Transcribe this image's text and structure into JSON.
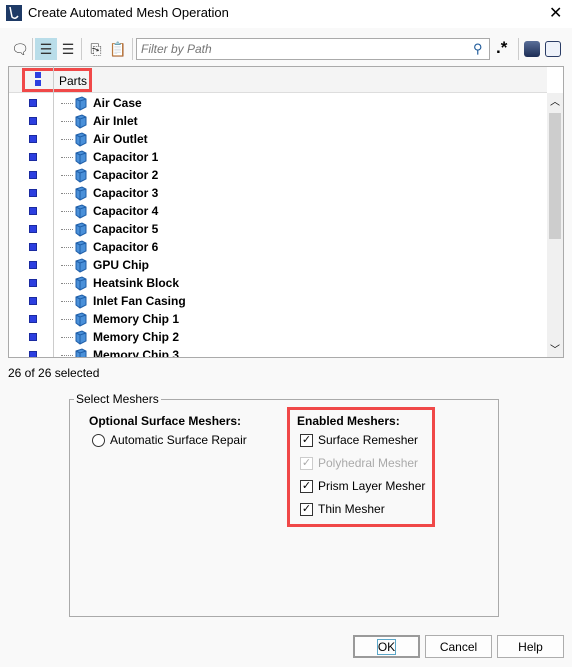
{
  "window": {
    "title": "Create Automated Mesh Operation",
    "close": "✕"
  },
  "toolbar": {
    "filter_placeholder": "Filter by Path",
    "regex": ".*"
  },
  "grid": {
    "header": "Parts",
    "items": [
      "Air Case",
      "Air Inlet",
      "Air Outlet",
      "Capacitor 1",
      "Capacitor 2",
      "Capacitor 3",
      "Capacitor 4",
      "Capacitor 5",
      "Capacitor 6",
      "GPU Chip",
      "Heatsink Block",
      "Inlet Fan Casing",
      "Memory Chip 1",
      "Memory Chip 2",
      "Memory Chip 3"
    ]
  },
  "status": "26 of 26 selected",
  "meshers": {
    "group_label": "Select Meshers",
    "optional_title": "Optional Surface Meshers:",
    "optional": [
      {
        "label": "Automatic Surface Repair",
        "selected": false
      }
    ],
    "enabled_title": "Enabled Meshers:",
    "enabled": [
      {
        "label": "Surface Remesher",
        "checked": true,
        "disabled": false
      },
      {
        "label": "Polyhedral Mesher",
        "checked": true,
        "disabled": true
      },
      {
        "label": "Prism Layer Mesher",
        "checked": true,
        "disabled": false
      },
      {
        "label": "Thin Mesher",
        "checked": true,
        "disabled": false
      }
    ]
  },
  "buttons": {
    "ok": "OK",
    "cancel": "Cancel",
    "help": "Help"
  },
  "colors": {
    "highlight": "#f04848",
    "selection_square": "#2c3fe0"
  }
}
